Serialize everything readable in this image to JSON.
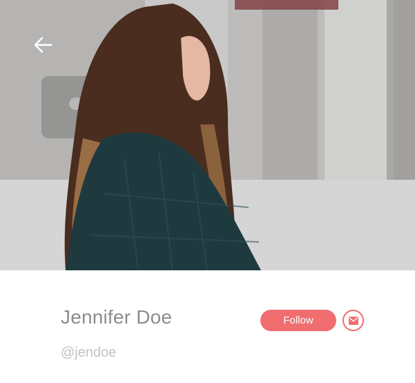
{
  "header": {
    "back_icon": "arrow-left-icon"
  },
  "profile": {
    "name": "Jennifer Doe",
    "handle": "@jendoe",
    "follow_label": "Follow",
    "message_icon": "mail-icon"
  },
  "colors": {
    "accent": "#f06d70",
    "name_text": "#8c8c8c",
    "handle_text": "#c2c2c2"
  }
}
